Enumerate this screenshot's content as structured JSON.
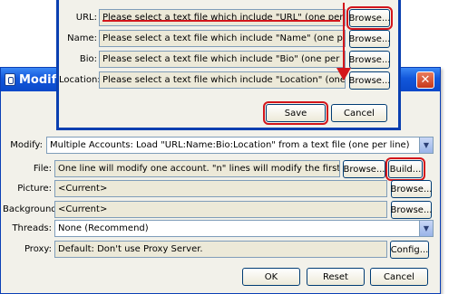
{
  "front_dialog": {
    "rows": [
      {
        "label": "URL:",
        "value": "Please select a text file which include \"URL\" (one per line)",
        "button": "Browse..."
      },
      {
        "label": "Name:",
        "value": "Please select a text file which include \"Name\" (one per line)",
        "button": "Browse..."
      },
      {
        "label": "Bio:",
        "value": "Please select a text file which include \"Bio\" (one per line)",
        "button": "Browse..."
      },
      {
        "label": "Location:",
        "value": "Please select a text file which include \"Location\" (one per line)",
        "button": "Browse..."
      }
    ],
    "save_label": "Save",
    "cancel_label": "Cancel"
  },
  "modify_dialog": {
    "title": "Modify",
    "close_glyph": "✕",
    "modify_label": "Modify:",
    "modify_value": "Multiple Accounts: Load \"URL:Name:Bio:Location\" from a text file (one per line)",
    "file_label": "File:",
    "file_value": "One line will modify one account. \"n\" lines will modify the first \"n\" accounts.",
    "file_browse": "Browse...",
    "file_build": "Build...",
    "picture_label": "Picture:",
    "picture_value": "<Current>",
    "picture_browse": "Browse...",
    "background_label": "Background:",
    "background_value": "<Current>",
    "background_browse": "Browse...",
    "threads_label": "Threads:",
    "threads_value": "None (Recommend)",
    "proxy_label": "Proxy:",
    "proxy_value": "Default: Don't use Proxy Server.",
    "proxy_config": "Config...",
    "ok_label": "OK",
    "reset_label": "Reset",
    "cancel_label": "Cancel"
  },
  "colors": {
    "highlight": "#d3151b",
    "titlebar": "#0a49c9"
  }
}
